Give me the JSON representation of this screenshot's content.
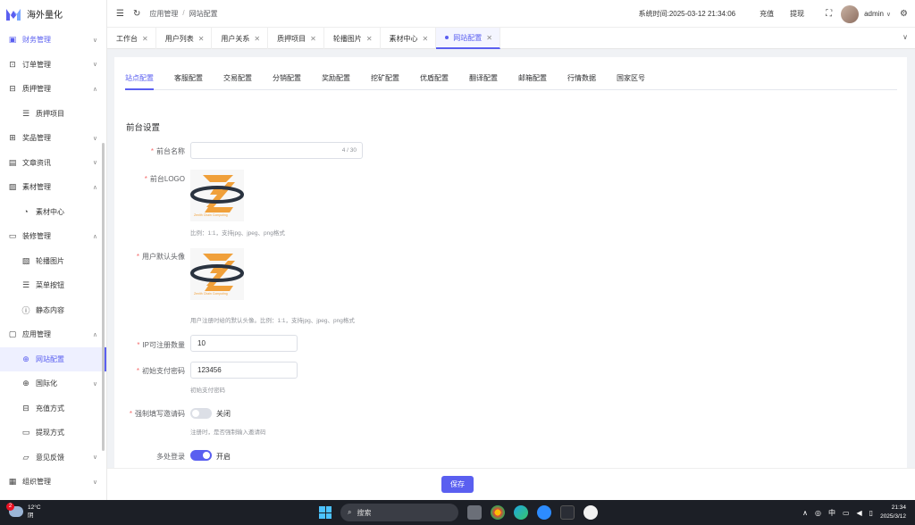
{
  "app": {
    "name": "海外量化"
  },
  "sidebar": {
    "items": [
      {
        "label": "财务管理",
        "icon": "wallet-icon",
        "arrow": "⌄"
      },
      {
        "label": "订单管理",
        "icon": "order-icon",
        "arrow": "⌄"
      },
      {
        "label": "质押管理",
        "icon": "pledge-icon",
        "arrow": "⌃"
      },
      {
        "label": "质押项目",
        "icon": "list-icon"
      },
      {
        "label": "奖品管理",
        "icon": "gift-icon",
        "arrow": "⌄"
      },
      {
        "label": "文章资讯",
        "icon": "article-icon",
        "arrow": "⌄"
      },
      {
        "label": "素材管理",
        "icon": "image-icon",
        "arrow": "⌃"
      },
      {
        "label": "素材中心",
        "icon": "dashboard-icon"
      },
      {
        "label": "装修管理",
        "icon": "brush-icon",
        "arrow": "⌃"
      },
      {
        "label": "轮播图片",
        "icon": "picture-icon"
      },
      {
        "label": "菜单按钮",
        "icon": "list-icon"
      },
      {
        "label": "静态内容",
        "icon": "info-icon"
      },
      {
        "label": "应用管理",
        "icon": "app-icon",
        "arrow": "⌃"
      },
      {
        "label": "网站配置",
        "icon": "globe-icon"
      },
      {
        "label": "国际化",
        "icon": "globe-icon",
        "arrow": "⌄"
      },
      {
        "label": "充值方式",
        "icon": "recharge-icon"
      },
      {
        "label": "提现方式",
        "icon": "folder-icon"
      },
      {
        "label": "意见反馈",
        "icon": "feedback-icon",
        "arrow": "⌄"
      },
      {
        "label": "组织管理",
        "icon": "org-icon",
        "arrow": "⌄"
      }
    ]
  },
  "header": {
    "breadcrumb": [
      "应用管理",
      "网站配置"
    ],
    "breadcrumb_sep": "/",
    "system_time_label": "系统时间:",
    "system_time": "2025-03-12 21:34:06",
    "recharge_link": "充值",
    "withdraw_link": "提现",
    "username": "admin"
  },
  "tabs": [
    {
      "label": "工作台"
    },
    {
      "label": "用户列表"
    },
    {
      "label": "用户关系"
    },
    {
      "label": "质押项目"
    },
    {
      "label": "轮播图片"
    },
    {
      "label": "素材中心"
    },
    {
      "label": "网站配置"
    }
  ],
  "subtabs": [
    "站点配置",
    "客服配置",
    "交易配置",
    "分销配置",
    "奖励配置",
    "挖矿配置",
    "优盾配置",
    "翻译配置",
    "邮箱配置",
    "行情数据",
    "国家区号"
  ],
  "form": {
    "section_title": "前台设置",
    "site_name": {
      "label": "前台名称",
      "value": "",
      "count": "4 / 30"
    },
    "site_logo": {
      "label": "前台LOGO",
      "hint": "比例：1:1，支持jpg、jpeg、png格式",
      "logo_caption": "Zenith Chain Computing"
    },
    "default_avatar": {
      "label": "用户默认头像",
      "hint": "用户注册时给的默认头像。比例：1:1，支持jpg、jpeg、png格式",
      "logo_caption": "Zenith Chain Computing"
    },
    "ip_limit": {
      "label": "IP可注册数量",
      "value": "10"
    },
    "init_pay_password": {
      "label": "初始支付密码",
      "value": "123456",
      "hint": "初始支付密码"
    },
    "force_invite": {
      "label": "强制填写邀请码",
      "state": "关闭",
      "hint": "注册时，是否强制输入邀请码"
    },
    "multi_login": {
      "label": "多处登录",
      "state": "开启"
    }
  },
  "footer": {
    "save_label": "保存"
  },
  "taskbar": {
    "weather_temp": "12°C",
    "weather_desc": "阴",
    "weather_badge": "2",
    "search_placeholder": "搜索",
    "ime": "中",
    "time": "21:34",
    "date": "2025/3/12"
  },
  "colors": {
    "accent": "#5a5ff0",
    "required": "#f56c6c",
    "taskbar": "#1c1f26"
  }
}
